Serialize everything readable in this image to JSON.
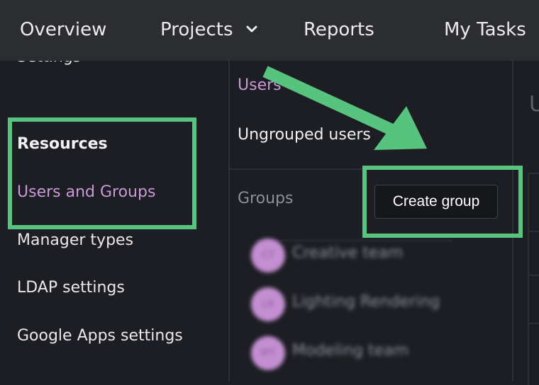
{
  "topnav": {
    "items": [
      {
        "label": "Overview"
      },
      {
        "label": "Projects"
      },
      {
        "label": "Reports"
      },
      {
        "label": "My Tasks"
      }
    ]
  },
  "sidebar": {
    "settings_label": "Settings",
    "heading": "Resources",
    "items": [
      {
        "label": "Users and Groups",
        "active": true
      },
      {
        "label": "Manager types"
      },
      {
        "label": "LDAP settings"
      },
      {
        "label": "Google Apps settings"
      }
    ]
  },
  "middle": {
    "users_link": "Users",
    "ungrouped_link": "Ungrouped users",
    "groups_label": "Groups",
    "create_group_button": "Create group",
    "groups": [
      {
        "initials": "CT",
        "name": "Creative team"
      },
      {
        "initials": "LR",
        "name": "Lighting Rendering"
      },
      {
        "initials": "MT",
        "name": "Modeling team"
      }
    ]
  },
  "right_panel": {
    "partial_letter": "U"
  },
  "colors": {
    "accent_purple": "#c99ad6",
    "highlight_green": "#57c37e",
    "background": "#1c1e23",
    "topbar": "#2b2d31"
  },
  "icons": {
    "projects_dropdown": "chevron-down-icon",
    "annotation": "arrow-icon"
  }
}
